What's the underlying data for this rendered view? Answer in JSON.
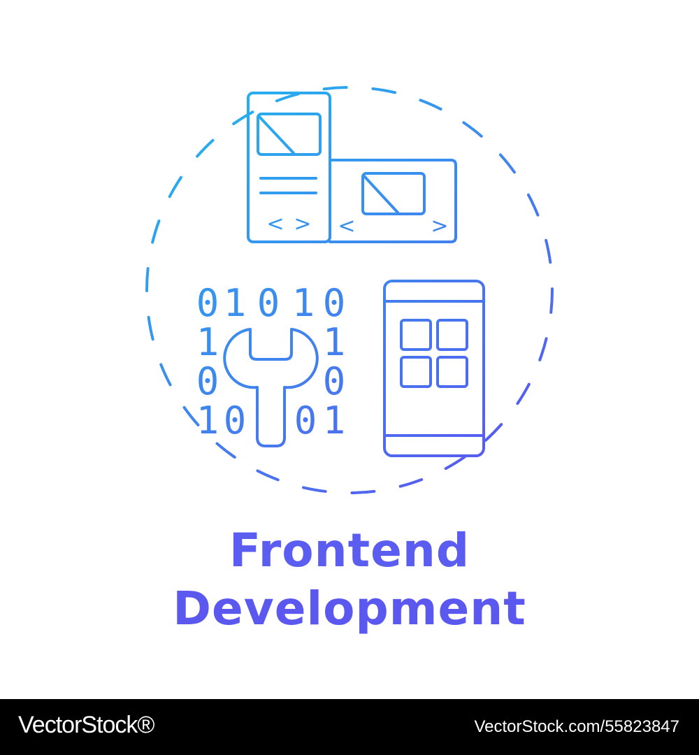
{
  "title": {
    "line1": "Frontend",
    "line2": "Development"
  },
  "icons": [
    "dashed-circle-icon",
    "web-layout-panels-icon",
    "binary-code-wrench-icon",
    "smartphone-app-grid-icon"
  ],
  "binary_digits": {
    "row1": [
      "0",
      "1",
      "0",
      "1",
      "0"
    ],
    "left_column": [
      "1",
      "0"
    ],
    "right_column": [
      "1",
      "0"
    ],
    "row4_left": [
      "1",
      "0"
    ],
    "row4_right": [
      "0",
      "1"
    ]
  },
  "code_chevrons": [
    "<",
    ">",
    "<",
    ">"
  ],
  "colors": {
    "gradient_start": "#22b7ee",
    "gradient_end": "#5b55ef",
    "background": "#ffffff",
    "footer_background": "#000000",
    "footer_text": "#ffffff"
  },
  "footer": {
    "brand": "VectorStock®",
    "image_id": "VectorStock.com/55823847"
  }
}
